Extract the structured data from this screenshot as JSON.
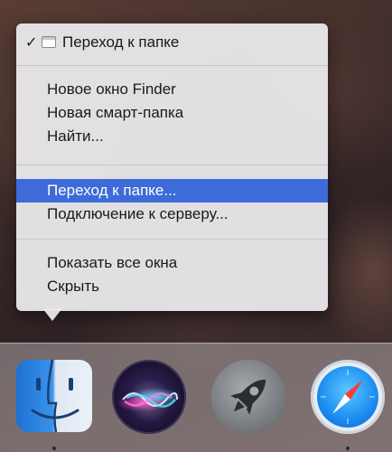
{
  "menu": {
    "header_item": {
      "label": "Переход к папке",
      "checked": true
    },
    "items_group1": [
      {
        "label": "Новое окно Finder"
      },
      {
        "label": "Новая смарт-папка"
      },
      {
        "label": "Найти..."
      }
    ],
    "items_group2": [
      {
        "label": "Переход к папке...",
        "highlighted": true
      },
      {
        "label": "Подключение к серверу..."
      }
    ],
    "items_group3": [
      {
        "label": "Показать все окна"
      },
      {
        "label": "Скрыть"
      }
    ],
    "check_glyph": "✓",
    "highlight_color": "#3d6bd9"
  },
  "dock": {
    "apps": [
      {
        "name": "Finder",
        "icon": "finder-icon",
        "running": true
      },
      {
        "name": "Siri",
        "icon": "siri-icon",
        "running": false
      },
      {
        "name": "Launchpad",
        "icon": "launchpad-icon",
        "running": false
      },
      {
        "name": "Safari",
        "icon": "safari-icon",
        "running": true
      }
    ]
  }
}
